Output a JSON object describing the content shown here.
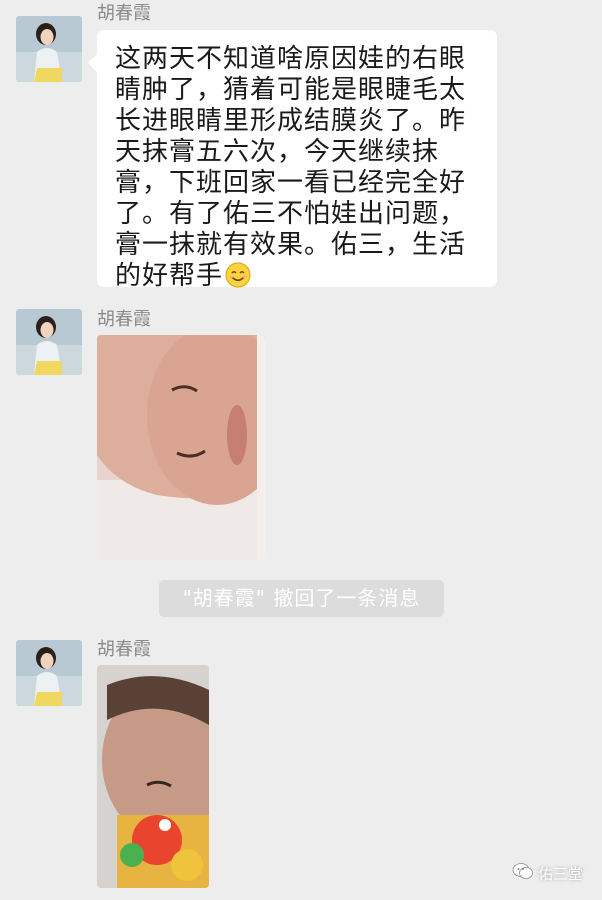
{
  "chat": {
    "messages": [
      {
        "sender": "胡春霞",
        "type": "text",
        "text": "这两天不知道啥原因娃的右眼睛肿了，猜着可能是眼睫毛太长进眼睛里形成结膜炎了。昨天抹膏五六次，今天继续抹膏，下班回家一看已经完全好了。有了佑三不怕娃出问题，膏一抹就有效果。佑三，生活的好帮手",
        "trailing_emoji": "smiling-face-emoji"
      },
      {
        "sender": "胡春霞",
        "type": "image",
        "image_desc": "baby-face-photo"
      },
      {
        "type": "system",
        "text": "\"胡春霞\" 撤回了一条消息"
      },
      {
        "sender": "胡春霞",
        "type": "image",
        "image_desc": "baby-with-toy-photo"
      }
    ]
  },
  "watermark": {
    "text": "佑三堂",
    "icon": "wechat-official-account-icon"
  },
  "colors": {
    "background": "#ededed",
    "bubble": "#ffffff",
    "sender_name": "#8a8a8a",
    "system_notice_bg": "#dcdcdc"
  }
}
